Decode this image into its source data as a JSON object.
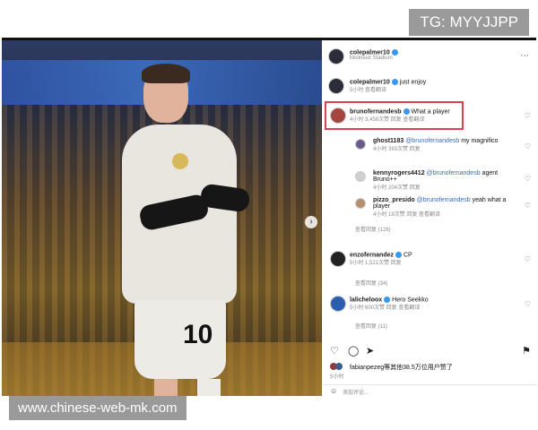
{
  "watermarks": {
    "top": "TG: MYYJJPP",
    "bottom": "www.chinese-web-mk.com"
  },
  "photo": {
    "shirt_number": "10",
    "next_icon": "chevron-right-icon"
  },
  "post": {
    "author": {
      "username": "colepalmer10",
      "location": "Molineux Stadium"
    },
    "caption": {
      "username": "colepalmer10",
      "text": "just enjoy",
      "meta": "5小时 查看翻译"
    }
  },
  "comments": [
    {
      "username": "brunofernandesb",
      "text": "What a player",
      "meta": "4小时 3,458次赞 回复 查看翻译",
      "highlighted": true
    },
    {
      "username": "ghost1183",
      "mention": "@brunofernandesb",
      "text": "my magnifico",
      "meta": "4小时 393次赞 回复",
      "reply": true
    },
    {
      "username": "kennyrogers4412",
      "mention": "@brunofernandesb",
      "text": "agent Bruno++",
      "meta": "4小时 204次赞 回复",
      "reply": true
    },
    {
      "username": "pizzo_presido",
      "mention": "@brunofernandesb",
      "text": "yeah what a player",
      "meta": "4小时 18次赞 回复 查看翻译",
      "reply": true
    },
    {
      "username": "",
      "text": "查看回复 (126)",
      "meta": "",
      "view_more": true
    },
    {
      "username": "enzofernandez",
      "text": "CP",
      "meta": "5小时 1,521次赞 回复"
    },
    {
      "username": "",
      "text": "查看回复 (34)",
      "meta": "",
      "view_more": true
    },
    {
      "username": "lalicheloox",
      "text": "Hero Seekko",
      "meta": "5小时 600次赞 回复 查看翻译"
    },
    {
      "username": "",
      "text": "查看回复 (11)",
      "meta": "",
      "view_more": true
    }
  ],
  "footer": {
    "liked_by": "fabianpezeg等其他38.5万位用户赞了",
    "date": "5小时",
    "comment_placeholder": "添加评论..."
  }
}
